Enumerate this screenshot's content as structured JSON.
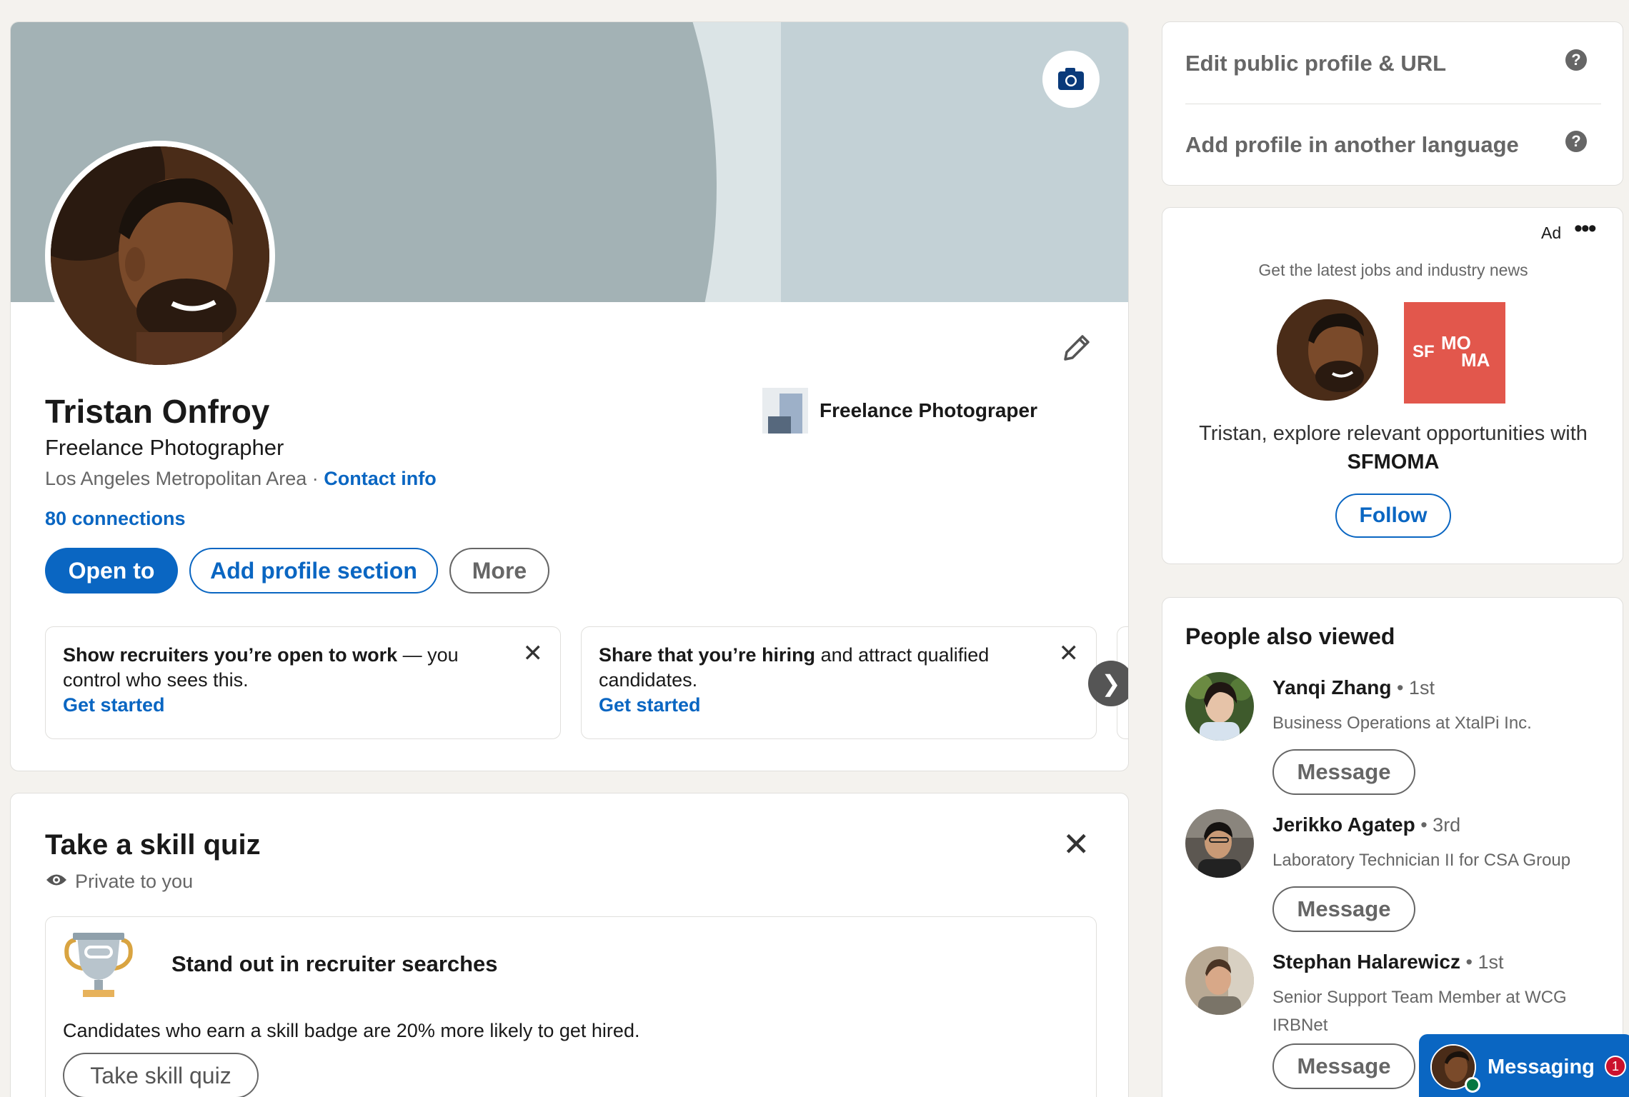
{
  "profile": {
    "name": "Tristan Onfroy",
    "headline": "Freelance Photographer",
    "location": "Los Angeles Metropolitan Area",
    "location_sep": " · ",
    "contact_info": "Contact info",
    "connections": "80 connections",
    "company": "Freelance Photograper",
    "buttons": {
      "open_to": "Open to",
      "add_section": "Add profile section",
      "more": "More"
    }
  },
  "promos": [
    {
      "bold": "Show recruiters you’re open to work",
      "rest": " — you control who sees this.",
      "cta": "Get started"
    },
    {
      "bold": "Share that you’re hiring",
      "rest": " and attract qualified candidates.",
      "cta": "Get started"
    }
  ],
  "quiz": {
    "title": "Take a skill quiz",
    "privacy": "Private to you",
    "card_heading": "Stand out in recruiter searches",
    "card_desc": "Candidates who earn a skill badge are 20% more likely to get hired.",
    "button": "Take skill quiz"
  },
  "sidebar": {
    "edit_public": "Edit public profile & URL",
    "add_language": "Add profile in another language"
  },
  "ad": {
    "label": "Ad",
    "tagline": "Get the latest jobs and industry news",
    "text_prefix": "Tristan, explore relevant opportunities with ",
    "company": "SFMOMA",
    "logo_top": "MO",
    "logo_sf": "SF",
    "logo_bottom": "MA",
    "follow": "Follow"
  },
  "people_also_viewed": {
    "title": "People also viewed",
    "message_label": "Message",
    "people": [
      {
        "name": "Yanqi Zhang",
        "degree": " • 1st",
        "role": "Business Operations at XtalPi Inc."
      },
      {
        "name": "Jerikko Agatep",
        "degree": " • 3rd",
        "role": "Laboratory Technician II for CSA Group"
      },
      {
        "name": "Stephan Halarewicz",
        "degree": " • 1st",
        "role": "Senior Support Team Member at WCG IRBNet"
      }
    ]
  },
  "messaging": {
    "label": "Messaging",
    "unread": "1"
  },
  "colors": {
    "brand_blue": "#0a66c2",
    "sfmoma_red": "#e2574c",
    "badge_red": "#cb112d"
  },
  "icons": [
    "camera-icon",
    "pencil-icon",
    "close-icon",
    "chevron-right-icon",
    "eye-icon",
    "trophy-icon",
    "help-icon",
    "more-dots-icon"
  ]
}
